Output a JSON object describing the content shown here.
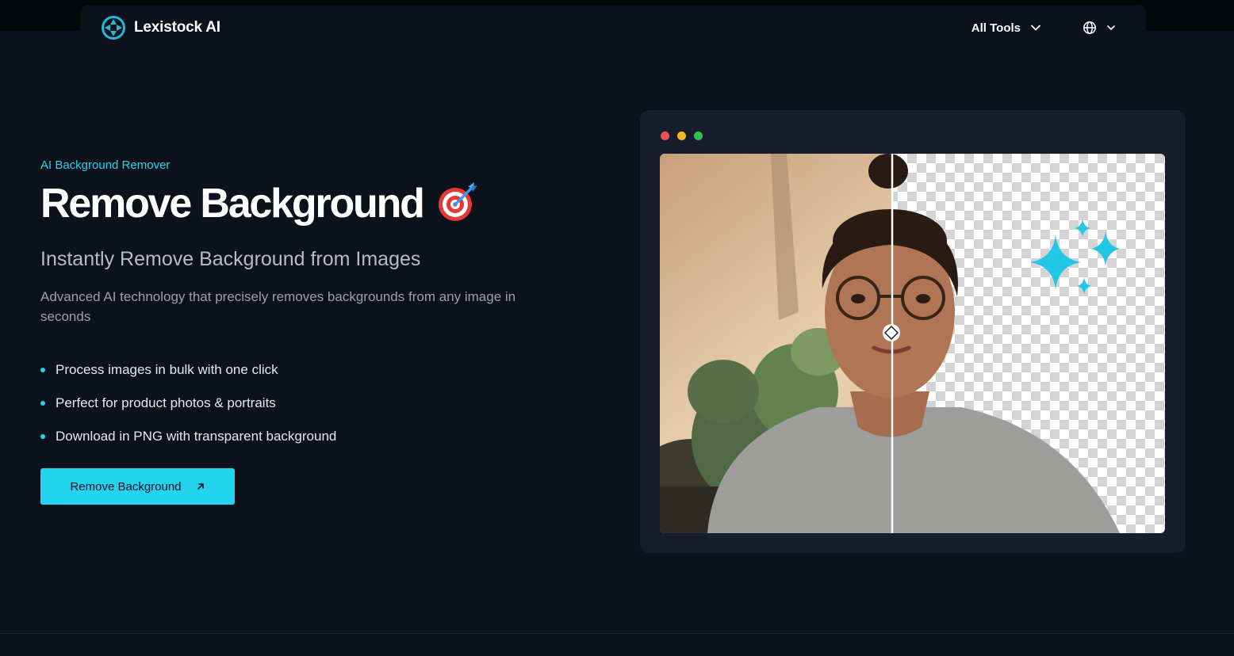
{
  "brand": {
    "name": "Lexistock AI",
    "icon": "aperture-logo-icon"
  },
  "nav": {
    "all_tools": "All Tools",
    "language_icon": "globe-icon"
  },
  "hero": {
    "eyebrow": "AI Background Remover",
    "title": "Remove Background",
    "title_icon": "dart-target-icon",
    "subtitle": "Instantly Remove Background from Images",
    "description": "Advanced AI technology that precisely removes backgrounds from any image in seconds",
    "features": [
      "Process images in bulk with one click",
      "Perfect for product photos & portraits",
      "Download in PNG with transparent background"
    ],
    "cta_label": "Remove Background"
  },
  "preview": {
    "window_dots": [
      "#ef5350",
      "#f5b82e",
      "#2ec44a"
    ],
    "split_fraction": 0.46
  },
  "colors": {
    "accent": "#22d3ee",
    "background": "#0c111b",
    "card": "#171d2a"
  }
}
